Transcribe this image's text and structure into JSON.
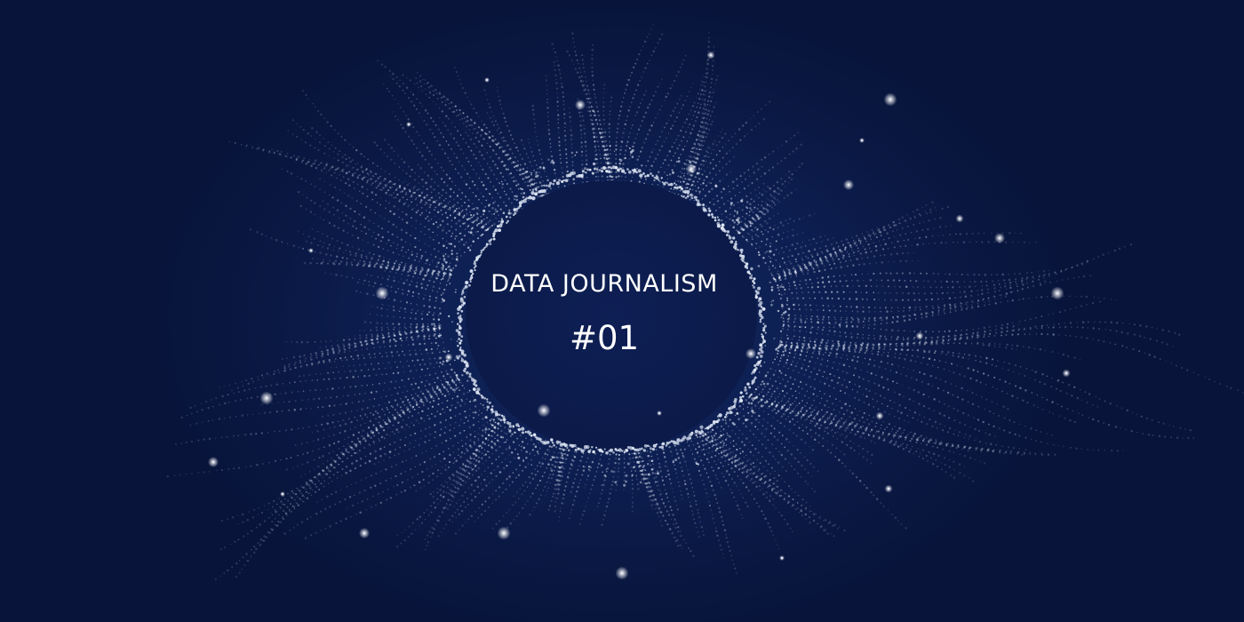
{
  "banner": {
    "title": "DATA JOURNALISM",
    "issue": "#01"
  },
  "colors": {
    "background": "#0b1a44",
    "particles": "#dfe7f5",
    "text": "#ffffff"
  }
}
